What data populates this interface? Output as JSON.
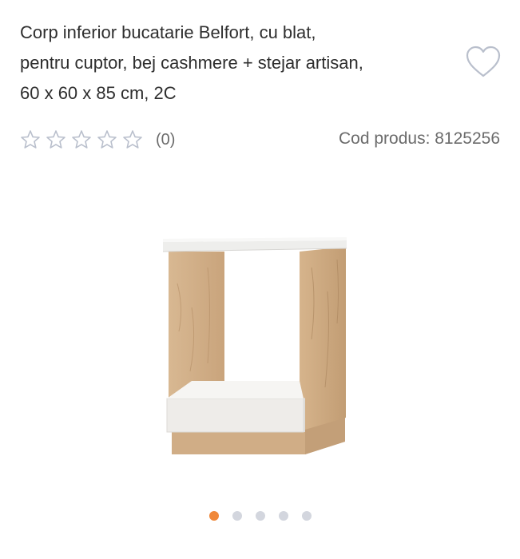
{
  "product": {
    "title_line1": "Corp inferior bucatarie Belfort, cu blat,",
    "title_line2": "pentru cuptor, bej cashmere + stejar artisan,",
    "title_line3": "60 x 60 x 85 cm, 2C",
    "rating_count": "(0)",
    "rating_value": 0,
    "rating_max": 5,
    "code_text": "Cod produs: 8125256"
  },
  "icons": {
    "favorite": "heart-outline-icon",
    "star": "star-outline-icon"
  },
  "gallery": {
    "total_slides": 5,
    "active_index": 0
  },
  "colors": {
    "accent": "#f0883a",
    "dot_inactive": "#d3d6de",
    "icon_outline": "#b9bfcc",
    "text_secondary": "#6b6b6b"
  }
}
